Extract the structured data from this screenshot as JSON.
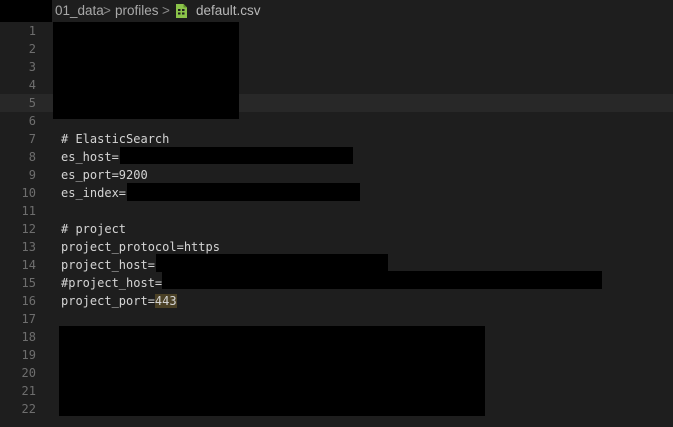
{
  "breadcrumb": {
    "root": "01_data",
    "folder": "profiles",
    "file": "default.csv",
    "separator": ">"
  },
  "editor": {
    "current_line": 5,
    "lines": [
      {
        "n": "1",
        "text": ""
      },
      {
        "n": "2",
        "text": ""
      },
      {
        "n": "3",
        "text": ""
      },
      {
        "n": "4",
        "text": ""
      },
      {
        "n": "5",
        "text": ""
      },
      {
        "n": "6",
        "text": ""
      },
      {
        "n": "7",
        "text": "# ElasticSearch"
      },
      {
        "n": "8",
        "text": "es_host="
      },
      {
        "n": "9",
        "text": "es_port=9200"
      },
      {
        "n": "10",
        "text": "es_index="
      },
      {
        "n": "11",
        "text": ""
      },
      {
        "n": "12",
        "text": "# project"
      },
      {
        "n": "13",
        "text": "project_protocol=https"
      },
      {
        "n": "14",
        "text": "project_host="
      },
      {
        "n": "15",
        "text": "#project_host="
      },
      {
        "n": "16",
        "text": "project_port=",
        "highlight": "443"
      },
      {
        "n": "17",
        "text": ""
      },
      {
        "n": "18",
        "text": ""
      },
      {
        "n": "19",
        "text": ""
      },
      {
        "n": "20",
        "text": ""
      },
      {
        "n": "21",
        "text": ""
      },
      {
        "n": "22",
        "text": ""
      }
    ]
  },
  "colors": {
    "background": "#1e1e1e",
    "current_line": "#282828",
    "text": "#d4d4d4",
    "gutter": "#6e6e6e",
    "csv_icon": "#8bc34a",
    "match_highlight": "#4b4126"
  }
}
